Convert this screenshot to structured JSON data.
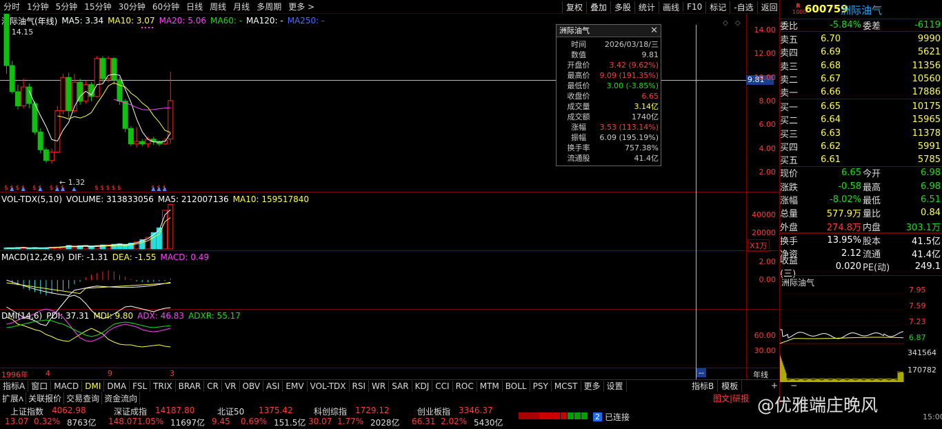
{
  "toolbar": {
    "periods": [
      "分时",
      "1分钟",
      "5分钟",
      "15分钟",
      "30分钟",
      "60分钟",
      "日线",
      "周线",
      "月线",
      "多周期",
      "更多 >"
    ],
    "right": [
      "复权",
      "叠加",
      "多股",
      "统计",
      "画线",
      "F10",
      "标记",
      "-自选",
      "返回"
    ]
  },
  "stock": {
    "code": "600759",
    "name": "洲际油气",
    "badge_top": "R",
    "badge_bottom": "1000"
  },
  "main_legend": {
    "name": "洲际油气(年线)",
    "ma5": "MA5: 3.34",
    "ma10": "MA10: 3.07",
    "ma20": "MA20: 5.06",
    "ma60": "MA60: -",
    "ma120": "MA120: -",
    "ma250": "MA250: -"
  },
  "price_marks": {
    "high_label": "14.15",
    "low_label": "1.32",
    "cursor_price": "9.81"
  },
  "price_axis": [
    "14.00",
    "12.00",
    "10.00",
    "8.00",
    "6.00",
    "4.00",
    "2.00"
  ],
  "vol_legend": {
    "name": "VOL-TDX(5,10)",
    "volume": "VOLUME: 313833056",
    "ma5": "MA5: 212007136",
    "ma10": "MA10: 159517840"
  },
  "vol_axis": [
    "40000",
    "20000"
  ],
  "vol_unit": "X1万",
  "macd_legend": {
    "name": "MACD(12,26,9)",
    "dif": "DIF: -1.31",
    "dea": "DEA: -1.55",
    "macd": "MACD: 0.49"
  },
  "macd_axis": [
    "2.00",
    "0.00"
  ],
  "dmi_legend": {
    "name": "DMI(14,6)",
    "pdi": "PDI: 37.31",
    "mdi": "MDI: 9.80",
    "adx": "ADX: 46.83",
    "adxr": "ADXR: 55.17"
  },
  "dmi_axis": [
    "60.00",
    "30.00"
  ],
  "x_axis": {
    "year": "1996年",
    "t1": "4",
    "t2": "9",
    "t3": "3",
    "cursor": "--",
    "period": "年线"
  },
  "popup": {
    "title": "洲际油气",
    "rows": [
      {
        "k": "时间",
        "v": "2026/03/18/三",
        "c": "#cccccc"
      },
      {
        "k": "数值",
        "v": "9.81",
        "c": "#cccccc"
      },
      {
        "k": "开盘价",
        "v": "3.42 (9.62%)",
        "c": "#ff3b3b"
      },
      {
        "k": "最高价",
        "v": "9.09 (191.35%)",
        "c": "#ff3b3b"
      },
      {
        "k": "最低价",
        "v": "3.00 (-3.85%)",
        "c": "#16e016"
      },
      {
        "k": "收盘价",
        "v": "6.65",
        "c": "#ff3b3b"
      },
      {
        "k": "成交量",
        "v": "3.14亿",
        "c": "#ffff3c"
      },
      {
        "k": "成交额",
        "v": "1740亿",
        "c": "#cccccc"
      },
      {
        "k": "涨幅",
        "v": "3.53 (113.14%)",
        "c": "#ff3b3b"
      },
      {
        "k": "振幅",
        "v": "6.09 (195.19%)",
        "c": "#cccccc"
      },
      {
        "k": "换手率",
        "v": "757.38%",
        "c": "#cccccc"
      },
      {
        "k": "流通股",
        "v": "41.4亿",
        "c": "#cccccc"
      }
    ]
  },
  "quote": {
    "wb": {
      "label": "委比",
      "value": "-5.84%",
      "label2": "委差",
      "value2": "-6119"
    },
    "asks": [
      {
        "l": "卖五",
        "p": "6.70",
        "v": "9990"
      },
      {
        "l": "卖四",
        "p": "6.69",
        "v": "5621"
      },
      {
        "l": "卖三",
        "p": "6.68",
        "v": "11356"
      },
      {
        "l": "卖二",
        "p": "6.67",
        "v": "10560"
      },
      {
        "l": "卖一",
        "p": "6.66",
        "v": "17886"
      }
    ],
    "bids": [
      {
        "l": "买一",
        "p": "6.65",
        "v": "10175"
      },
      {
        "l": "买二",
        "p": "6.64",
        "v": "15965"
      },
      {
        "l": "买三",
        "p": "6.63",
        "v": "11378"
      },
      {
        "l": "买四",
        "p": "6.62",
        "v": "5991"
      },
      {
        "l": "买五",
        "p": "6.61",
        "v": "5785"
      }
    ],
    "stats": [
      {
        "a": "现价",
        "b": "6.65",
        "bc": "#16e016",
        "c": "今开",
        "d": "6.98",
        "dc": "#16e016"
      },
      {
        "a": "涨跌",
        "b": "-0.58",
        "bc": "#16e016",
        "c": "最高",
        "d": "6.98",
        "dc": "#16e016"
      },
      {
        "a": "涨幅",
        "b": "-8.02%",
        "bc": "#16e016",
        "c": "最低",
        "d": "6.51",
        "dc": "#16e016"
      },
      {
        "a": "总量",
        "b": "577.9万",
        "bc": "#ffff3c",
        "c": "量比",
        "d": "0.84",
        "dc": "#ffff3c"
      },
      {
        "a": "外盘",
        "b": "274.8万",
        "bc": "#ff3b3b",
        "c": "内盘",
        "d": "303.1万",
        "dc": "#16e016"
      },
      {
        "a": "换手",
        "b": "13.95%",
        "bc": "#ffffff",
        "c": "股本",
        "d": "41.5亿",
        "dc": "#ffffff"
      },
      {
        "a": "净资",
        "b": "2.12",
        "bc": "#ffffff",
        "c": "流通",
        "d": "41.4亿",
        "dc": "#ffffff"
      },
      {
        "a": "收益(三)",
        "b": "0.020",
        "bc": "#ffffff",
        "c": "PE(动)",
        "d": "249.1",
        "dc": "#ffffff"
      }
    ]
  },
  "mini": {
    "title": "洲际油气",
    "prices": [
      "7.95",
      "7.59",
      "7.23",
      "6.87"
    ],
    "vols": [
      "341564",
      "170782"
    ]
  },
  "indicators": [
    "指标A",
    "窗口",
    "MACD",
    "DMI",
    "DMA",
    "FSL",
    "TRIX",
    "BRAR",
    "CR",
    "VR",
    "OBV",
    "ASI",
    "EMV",
    "VOL-TDX",
    "RSI",
    "WR",
    "SAR",
    "KDJ",
    "CCI",
    "ROC",
    "MTM",
    "BOLL",
    "PSY",
    "MCST",
    "更多",
    "设置"
  ],
  "ind_right": [
    "指标B",
    "模板"
  ],
  "bottom_tabs": [
    "扩展ʌ",
    "关联报价",
    "交易查询",
    "资金流向"
  ],
  "bottom_right": "图文|研报",
  "indices": [
    {
      "name": "上证指数",
      "val": "4062.98",
      "chg": "13.07",
      "pct": "0.32%",
      "amt": "8763亿"
    },
    {
      "name": "深证成指",
      "val": "14187.80",
      "chg": "148.07",
      "pct": "1.05%",
      "amt": "11697亿"
    },
    {
      "name": "北证50",
      "val": "1375.42",
      "chg": "9.45",
      "pct": "0.69%",
      "amt": "151.5亿"
    },
    {
      "name": "科创综指",
      "val": "1729.12",
      "chg": "30.07",
      "pct": "1.77%",
      "amt": "2028亿"
    },
    {
      "name": "创业板指",
      "val": "3346.37",
      "chg": "66.31",
      "pct": "2.02%",
      "amt": "5430亿"
    }
  ],
  "conn": {
    "num": "2",
    "text": "已连接"
  },
  "watermark": "@优雅端庄晚风",
  "time": "15:00"
}
